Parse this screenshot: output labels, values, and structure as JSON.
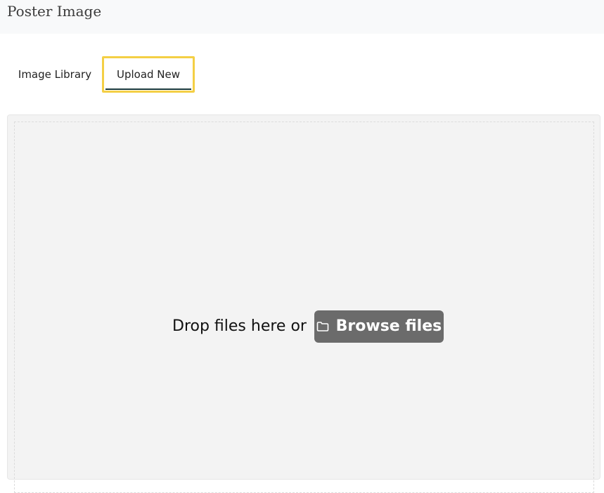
{
  "header": {
    "title": "Poster Image"
  },
  "tabs": [
    {
      "label": "Image Library",
      "active": false
    },
    {
      "label": "Upload New",
      "active": true
    }
  ],
  "dropzone": {
    "prompt": "Drop files here or",
    "browse_label": "Browse files",
    "browse_icon": "folder-icon"
  },
  "colors": {
    "header_bg": "#f8f9fa",
    "focus_outline": "#f4cf45",
    "active_underline": "#1d3a3a",
    "dropzone_bg": "#f3f3f3",
    "button_bg": "#6b6b6b"
  }
}
